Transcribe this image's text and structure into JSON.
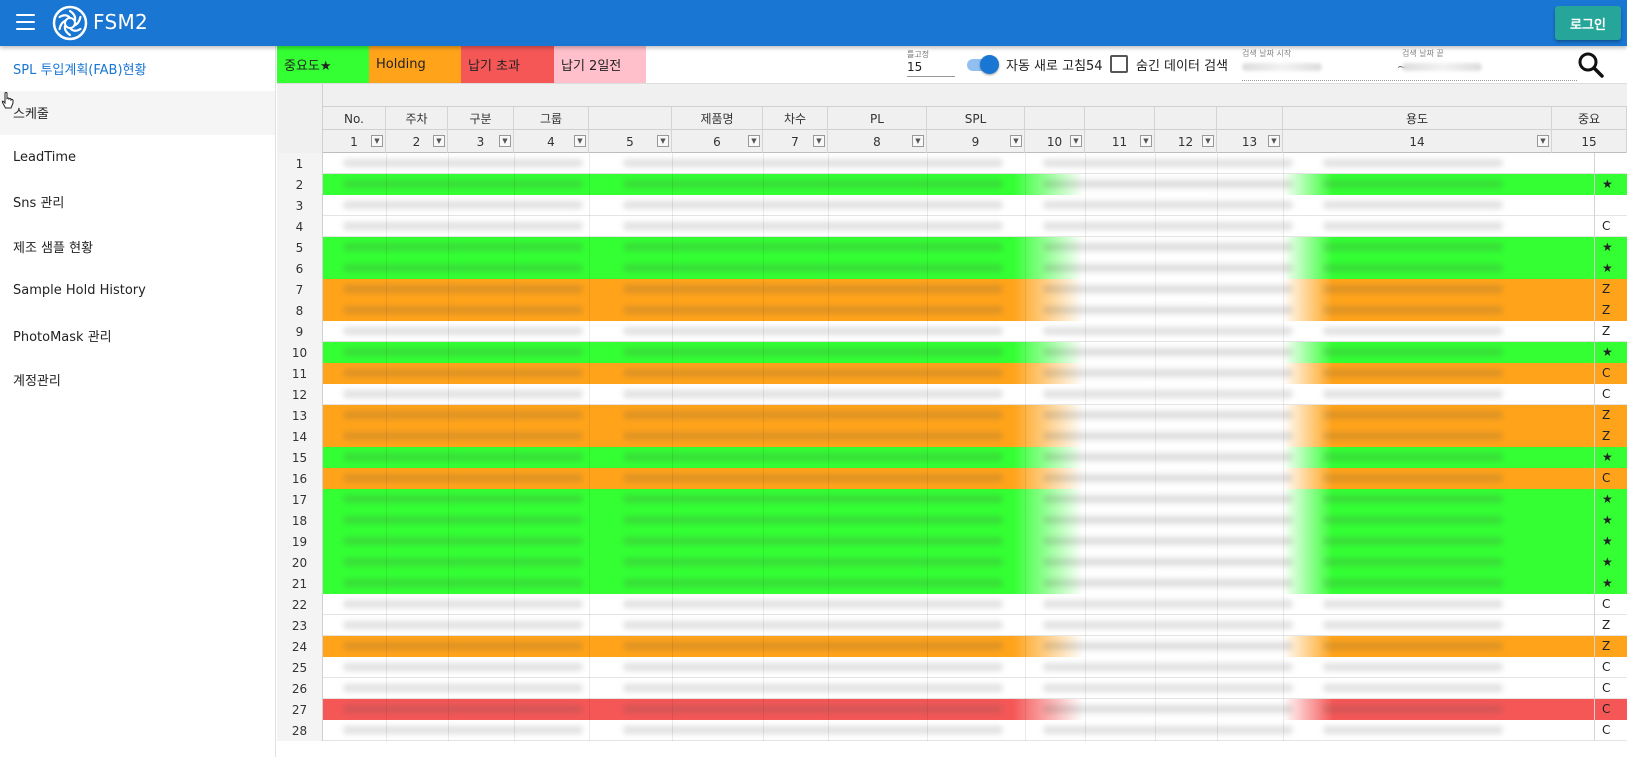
{
  "app": {
    "title": "FSM2",
    "login_label": "로그인"
  },
  "icons": {
    "menu": "hamburger-menu-icon",
    "logo": "aperture-logo-icon",
    "search": "search-icon",
    "cursor": "hand-pointer-icon"
  },
  "colors": {
    "appbar": "#1976d2",
    "login": "#26a69a",
    "important": "#33ff33",
    "holding": "#ffa31a",
    "overdue": "#f55757",
    "two_days": "#ffc0cb"
  },
  "sidebar": {
    "items": [
      {
        "label": "SPL 투입계획(FAB)현황"
      },
      {
        "label": "스케줄"
      },
      {
        "label": "LeadTime"
      },
      {
        "label": "Sns 관리"
      },
      {
        "label": "제조 샘플 현황"
      },
      {
        "label": "Sample Hold History"
      },
      {
        "label": "PhotoMask 관리"
      },
      {
        "label": "계정관리"
      }
    ]
  },
  "toolbar": {
    "legend": {
      "important": "중요도★",
      "holding": "Holding",
      "overdue": "납기 초과",
      "two_days": "납기 2일전"
    },
    "fix_label": "틀고정",
    "fix_value": "15",
    "auto_refresh_label": "자동 새로 고침54",
    "hidden_search_label": "숨긴 데이터 검색",
    "date_start_label": "검색 날짜 시작",
    "date_end_label": "검색 날짜 끝",
    "tilde": "~"
  },
  "grid": {
    "headers": [
      "No.",
      "주차",
      "구분",
      "그룹",
      "",
      "제품명",
      "차수",
      "PL",
      "SPL",
      "",
      "",
      "",
      "",
      "용도",
      "중요"
    ],
    "col_numbers": [
      "1",
      "2",
      "3",
      "4",
      "5",
      "6",
      "7",
      "8",
      "9",
      "10",
      "11",
      "12",
      "13",
      "14",
      "15"
    ],
    "rows": [
      {
        "n": "1",
        "status": "none",
        "mark": ""
      },
      {
        "n": "2",
        "status": "important",
        "mark": "★"
      },
      {
        "n": "3",
        "status": "none",
        "mark": ""
      },
      {
        "n": "4",
        "status": "none",
        "mark": "C"
      },
      {
        "n": "5",
        "status": "important",
        "mark": "★"
      },
      {
        "n": "6",
        "status": "important",
        "mark": "★"
      },
      {
        "n": "7",
        "status": "holding",
        "mark": "Z"
      },
      {
        "n": "8",
        "status": "holding",
        "mark": "Z"
      },
      {
        "n": "9",
        "status": "none",
        "mark": "Z"
      },
      {
        "n": "10",
        "status": "important",
        "mark": "★"
      },
      {
        "n": "11",
        "status": "holding",
        "mark": "C"
      },
      {
        "n": "12",
        "status": "none",
        "mark": "C"
      },
      {
        "n": "13",
        "status": "holding",
        "mark": "Z"
      },
      {
        "n": "14",
        "status": "holding",
        "mark": "Z"
      },
      {
        "n": "15",
        "status": "important",
        "mark": "★"
      },
      {
        "n": "16",
        "status": "holding",
        "mark": "C"
      },
      {
        "n": "17",
        "status": "important",
        "mark": "★"
      },
      {
        "n": "18",
        "status": "important",
        "mark": "★"
      },
      {
        "n": "19",
        "status": "important",
        "mark": "★"
      },
      {
        "n": "20",
        "status": "important",
        "mark": "★"
      },
      {
        "n": "21",
        "status": "important",
        "mark": "★"
      },
      {
        "n": "22",
        "status": "none",
        "mark": "C"
      },
      {
        "n": "23",
        "status": "none",
        "mark": "Z"
      },
      {
        "n": "24",
        "status": "holding",
        "mark": "Z"
      },
      {
        "n": "25",
        "status": "none",
        "mark": "C"
      },
      {
        "n": "26",
        "status": "none",
        "mark": "C"
      },
      {
        "n": "27",
        "status": "overdue",
        "mark": "C"
      },
      {
        "n": "28",
        "status": "none",
        "mark": "C"
      }
    ]
  }
}
